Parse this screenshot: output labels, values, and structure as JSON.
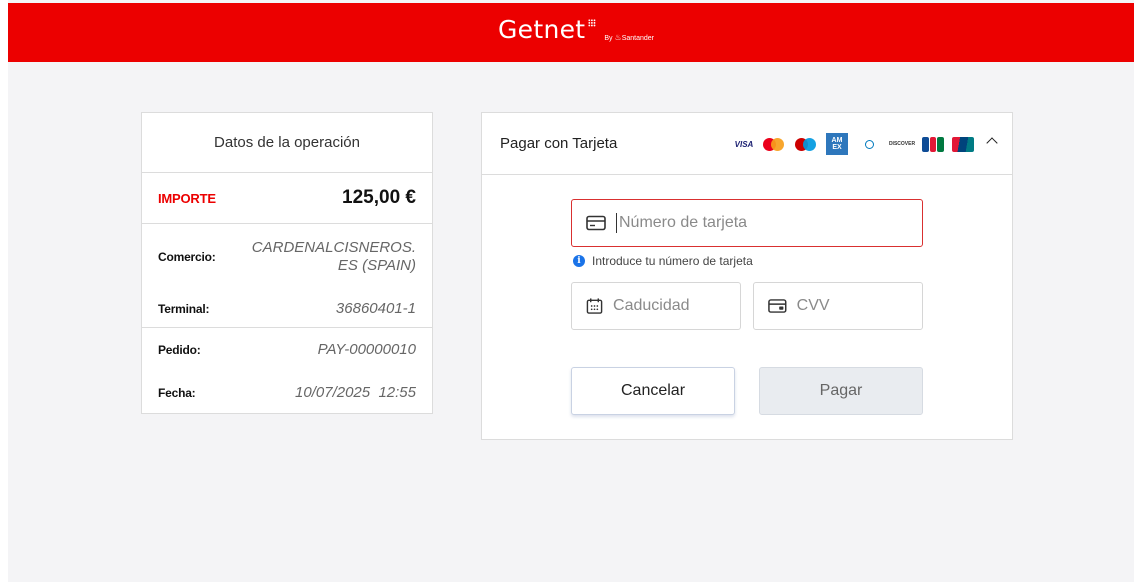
{
  "header": {
    "logo_text": "Getnet",
    "logo_by": "By",
    "logo_brand": "Santander",
    "bg_color": "#ec0000"
  },
  "summary": {
    "title": "Datos de la operación",
    "amount_label": "IMPORTE",
    "amount_value": "125,00 €",
    "merchant_label": "Comercio:",
    "merchant_value_line1": "CARDENALCISNEROS.",
    "merchant_value_line2": "ES (SPAIN)",
    "terminal_label": "Terminal:",
    "terminal_value": "36860401-1",
    "order_label": "Pedido:",
    "order_value": "PAY-00000010",
    "date_label": "Fecha:",
    "date_value": "10/07/2025  12:55"
  },
  "payment": {
    "title": "Pagar con Tarjeta",
    "brands": [
      "visa",
      "mastercard",
      "maestro",
      "amex",
      "diners",
      "discover",
      "jcb",
      "unionpay"
    ],
    "brand_visa": "VISA",
    "brand_amex_1": "AM",
    "brand_amex_2": "EX",
    "brand_discover": "DISCOVER",
    "card_number_placeholder": "Número de tarjeta",
    "card_number_hint": "Introduce tu número de tarjeta",
    "expiry_placeholder": "Caducidad",
    "cvv_placeholder": "CVV",
    "cancel_label": "Cancelar",
    "pay_label": "Pagar"
  }
}
